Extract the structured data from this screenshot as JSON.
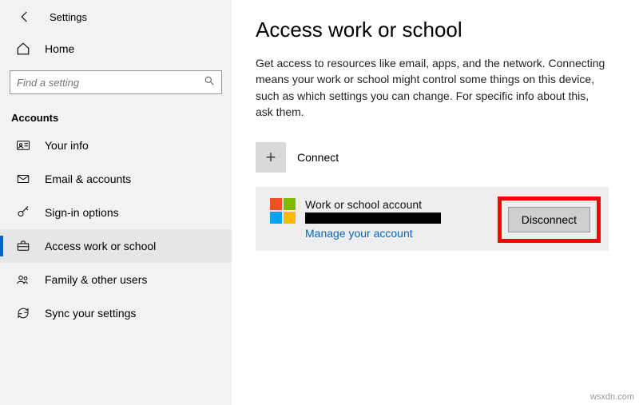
{
  "header": {
    "window_title": "Settings"
  },
  "sidebar": {
    "home_label": "Home",
    "search_placeholder": "Find a setting",
    "section_label": "Accounts",
    "items": [
      {
        "label": "Your info"
      },
      {
        "label": "Email & accounts"
      },
      {
        "label": "Sign-in options"
      },
      {
        "label": "Access work or school"
      },
      {
        "label": "Family & other users"
      },
      {
        "label": "Sync your settings"
      }
    ]
  },
  "main": {
    "title": "Access work or school",
    "description": "Get access to resources like email, apps, and the network. Connecting means your work or school might control some things on this device, such as which settings you can change. For specific info about this, ask them.",
    "connect_label": "Connect",
    "account": {
      "title": "Work or school account",
      "manage_label": "Manage your account",
      "disconnect_label": "Disconnect"
    }
  },
  "watermark": "wsxdn.com"
}
